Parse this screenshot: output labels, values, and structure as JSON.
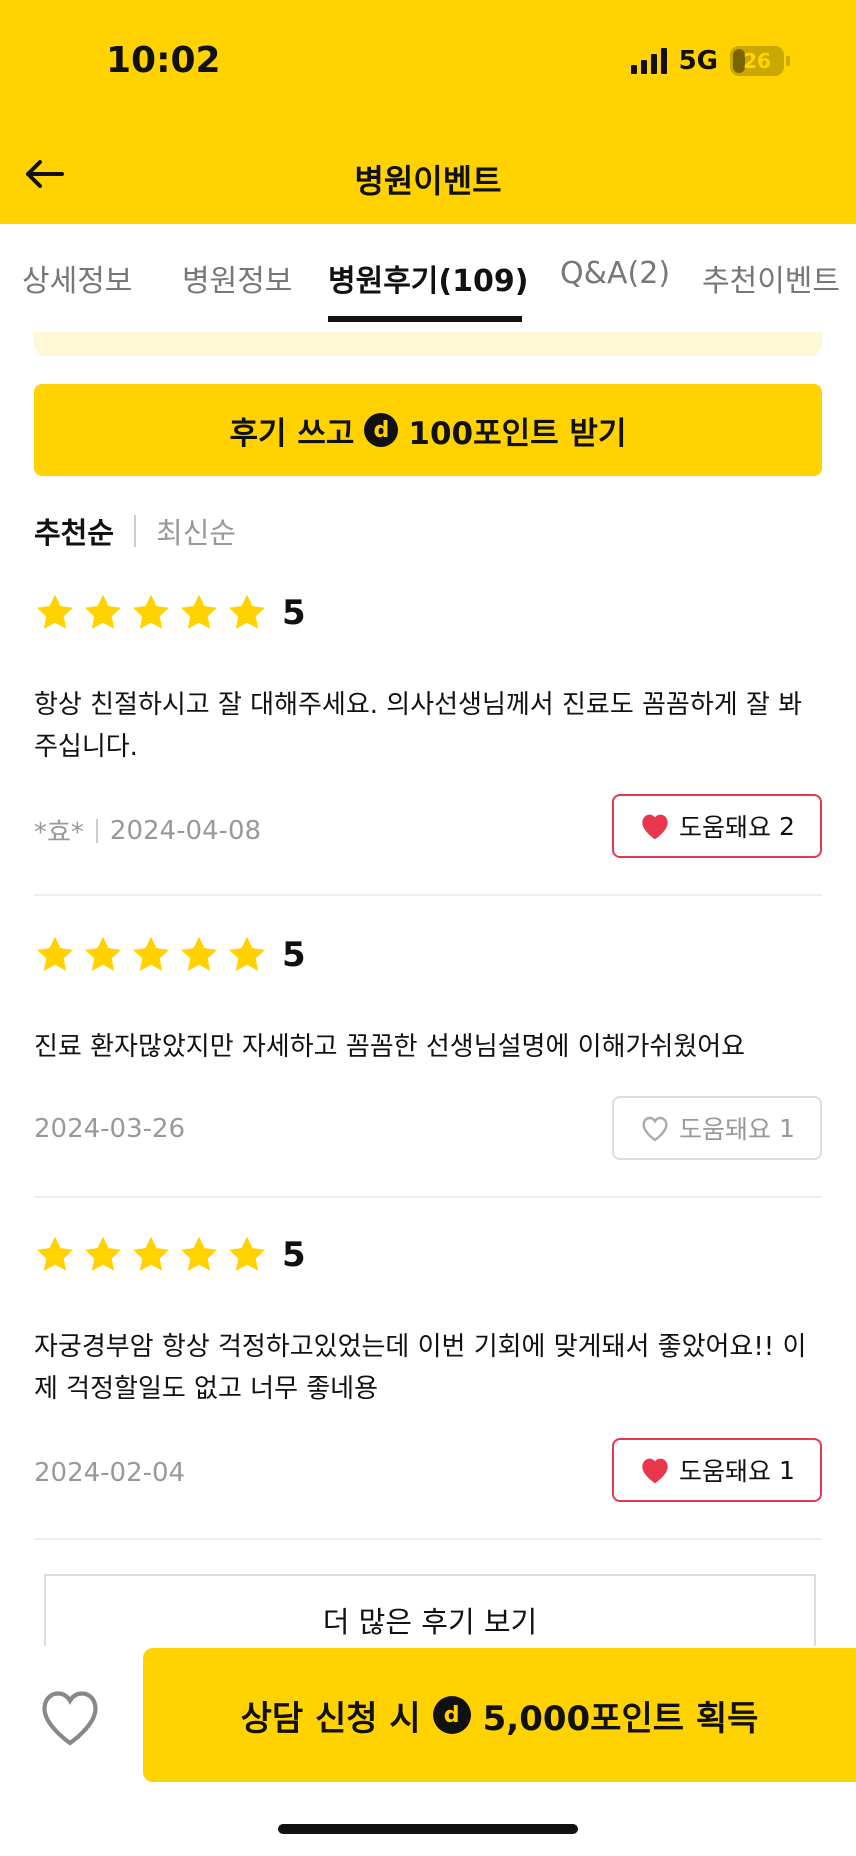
{
  "status_bar": {
    "time": "10:02",
    "network": "5G",
    "battery": "26",
    "battery_level": 0.26
  },
  "header": {
    "title": "병원이벤트"
  },
  "tabs": [
    {
      "label": "상세정보"
    },
    {
      "label": "병원정보"
    },
    {
      "label": "병원후기(109)"
    },
    {
      "label": "Q&A(2)"
    },
    {
      "label": "추천이벤트"
    }
  ],
  "active_tab": "병원후기(109)",
  "write_review": {
    "label_prefix": "후기 쓰고",
    "point_symbol": "d",
    "label_suffix": "100포인트 받기"
  },
  "sort": {
    "selected": "추천순",
    "other": "최신순"
  },
  "reviews": [
    {
      "rating": 5,
      "score": "5",
      "text": "항상 친절하시고 잘 대해주세요. 의사선생님께서 진료도 꼼꼼하게 잘 봐주십니다.",
      "author": "*효*",
      "date": "2024-04-08",
      "helpful_label": "도움돼요",
      "helpful_count": "2",
      "liked": true
    },
    {
      "rating": 5,
      "score": "5",
      "text": "진료 환자많았지만 자세하고 꼼꼼한 선생님설명에 이해가쉬웠어요",
      "author": "",
      "date": "2024-03-26",
      "helpful_label": "도움돼요",
      "helpful_count": "1",
      "liked": false
    },
    {
      "rating": 5,
      "score": "5",
      "text": "자궁경부암 항상 걱정하고있었는데 이번 기회에 맞게돼서 좋았어요!! 이제 걱정할일도 없고 너무 좋네용",
      "author": "",
      "date": "2024-02-04",
      "helpful_label": "도움돼요",
      "helpful_count": "1",
      "liked": true
    }
  ],
  "more_reviews": {
    "label": "더 많은 후기 보기"
  },
  "cta": {
    "label_prefix": "상담 신청 시",
    "point_symbol": "d",
    "label_suffix": "5,000포인트 획득"
  },
  "colors": {
    "brand": "#FFD200",
    "heart": "#E8364D",
    "text": "#111111",
    "muted": "#999999"
  }
}
